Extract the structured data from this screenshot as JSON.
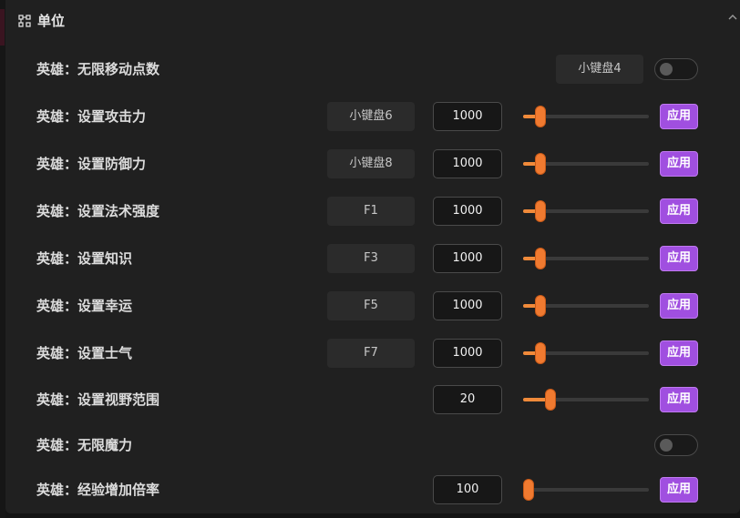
{
  "section": {
    "title": "单位",
    "icon": "grid-nodes-icon",
    "collapse_icon": "chevron-up-icon"
  },
  "rows": [
    {
      "label": "英雄：无限移动点数",
      "hotkey": "小键盘4",
      "toggle_on": false
    },
    {
      "label": "英雄：设置攻击力",
      "hotkey": "小键盘6",
      "value": "1000",
      "slider_level": 0.1,
      "apply": "应用"
    },
    {
      "label": "英雄：设置防御力",
      "hotkey": "小键盘8",
      "value": "1000",
      "slider_level": 0.1,
      "apply": "应用"
    },
    {
      "label": "英雄：设置法术强度",
      "hotkey": "F1",
      "value": "1000",
      "slider_level": 0.1,
      "apply": "应用"
    },
    {
      "label": "英雄：设置知识",
      "hotkey": "F3",
      "value": "1000",
      "slider_level": 0.1,
      "apply": "应用"
    },
    {
      "label": "英雄：设置幸运",
      "hotkey": "F5",
      "value": "1000",
      "slider_level": 0.1,
      "apply": "应用"
    },
    {
      "label": "英雄：设置士气",
      "hotkey": "F7",
      "value": "1000",
      "slider_level": 0.1,
      "apply": "应用"
    },
    {
      "label": "英雄：设置视野范围",
      "value": "20",
      "slider_level": 0.19,
      "apply": "应用"
    },
    {
      "label": "英雄：无限魔力",
      "toggle_on": false
    },
    {
      "label": "英雄：经验增加倍率",
      "value": "100",
      "slider_level": 0.0,
      "apply": "应用"
    }
  ],
  "colors": {
    "accent_button": "#a04fe0",
    "slider_thumb": "#f07a30"
  }
}
